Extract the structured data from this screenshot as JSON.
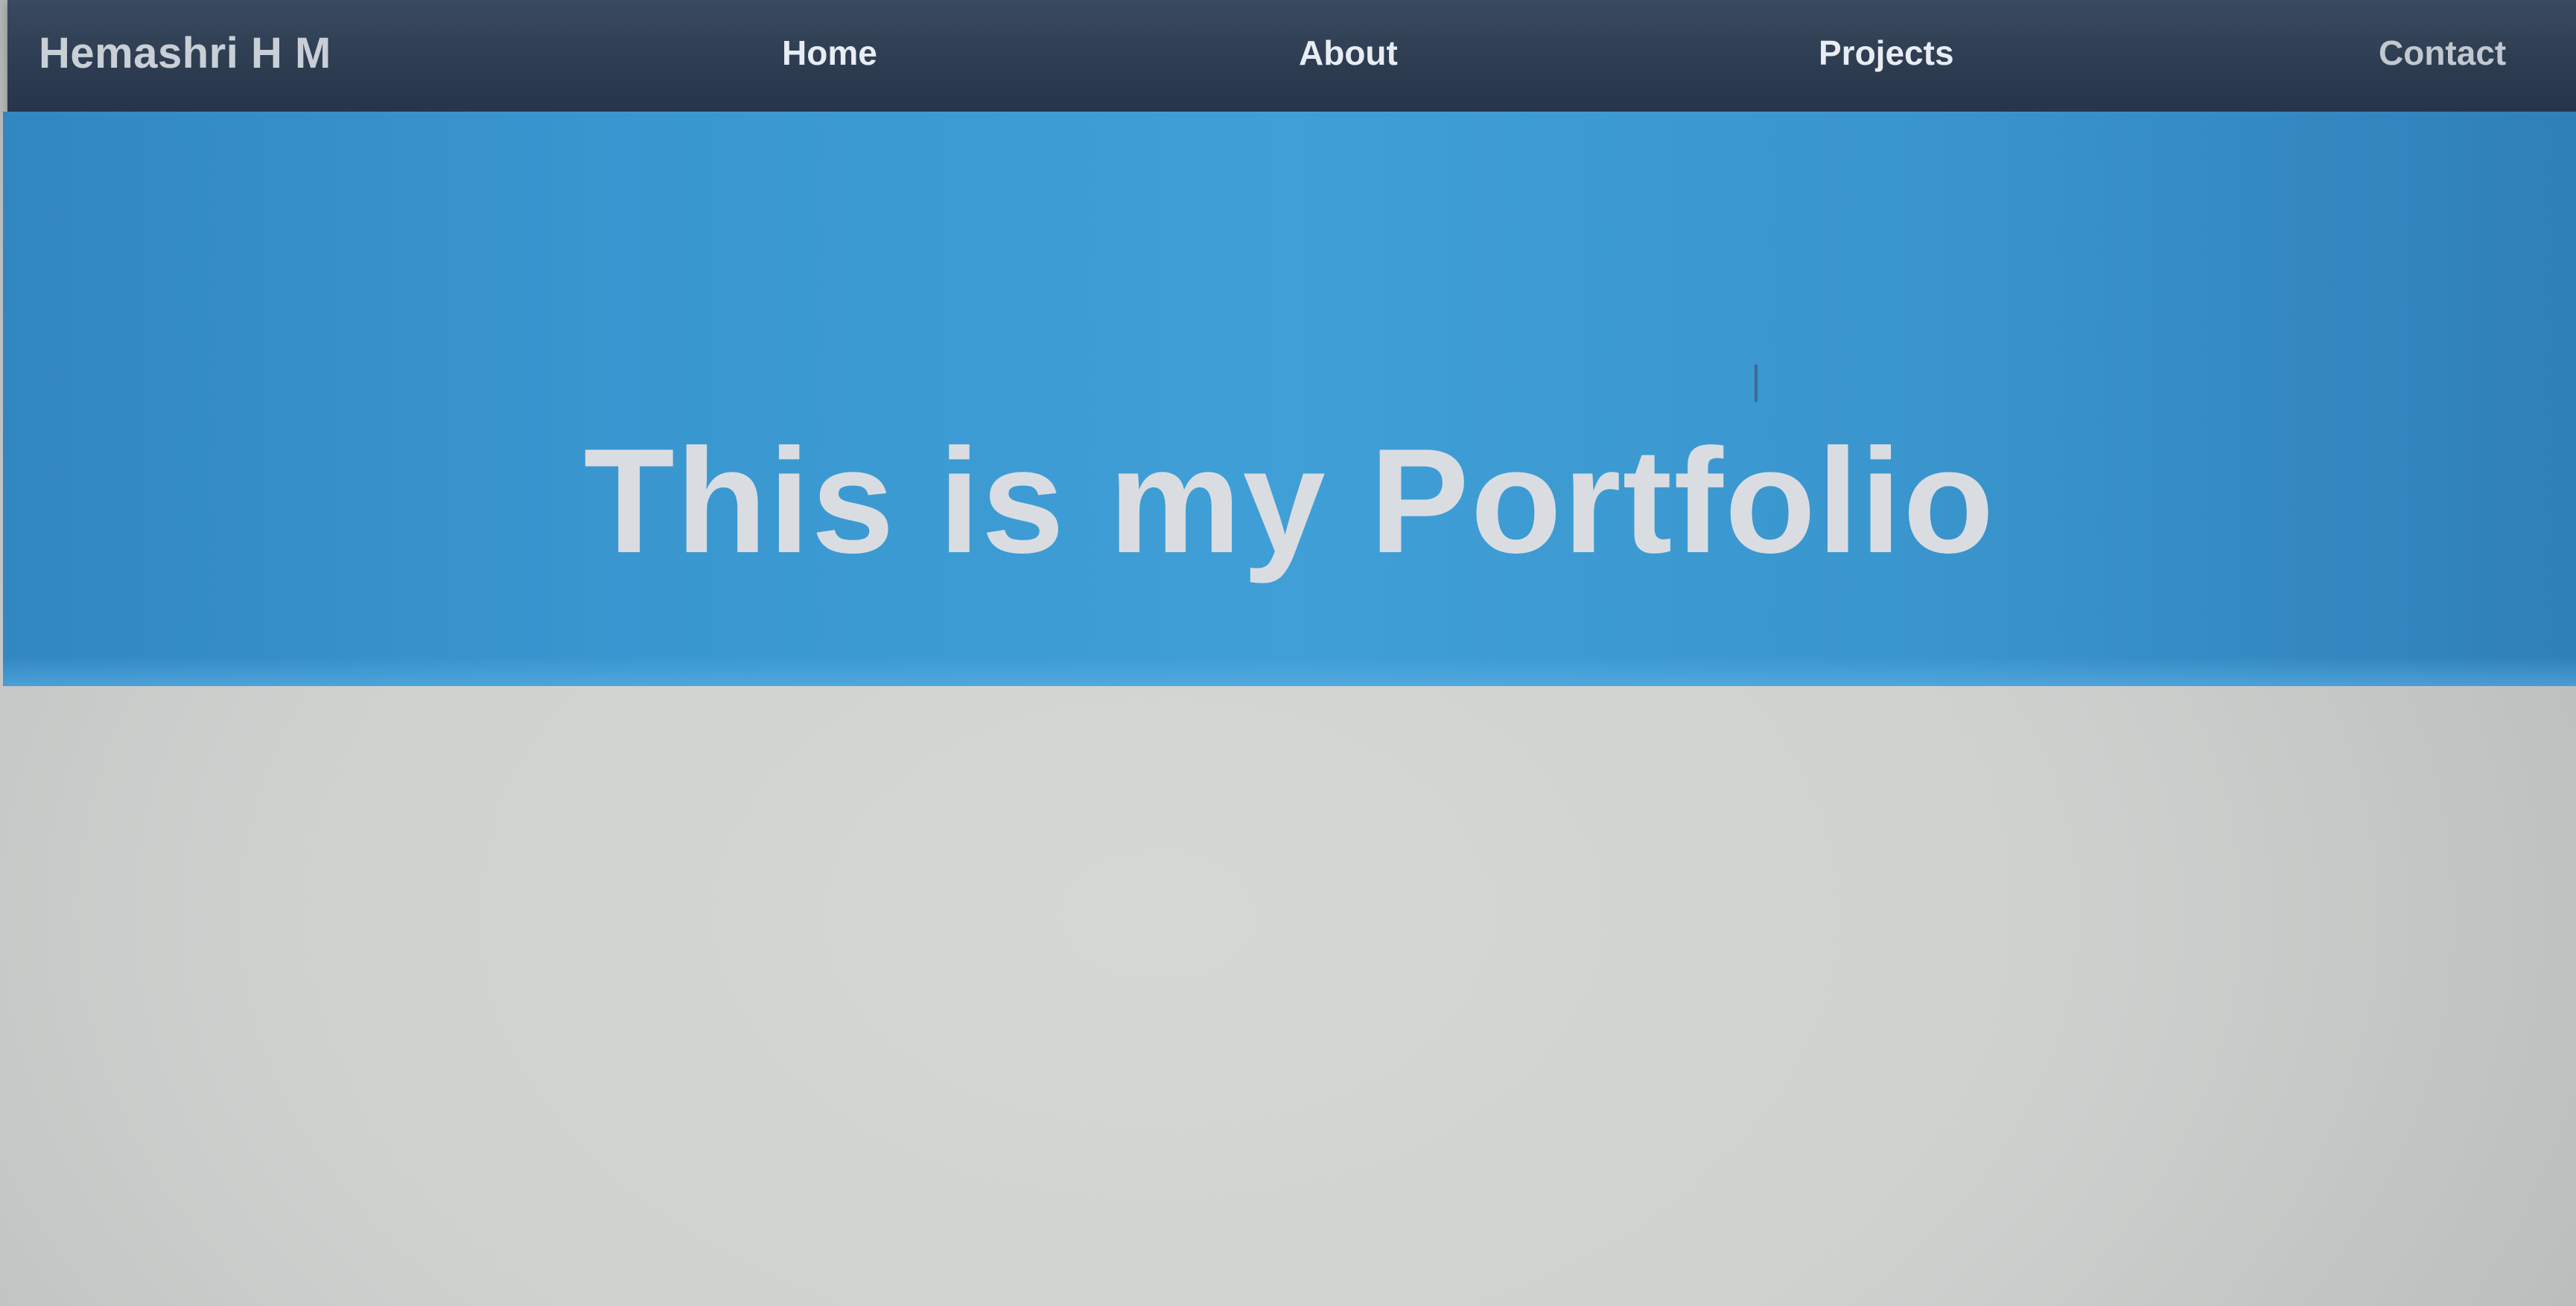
{
  "navbar": {
    "brand": "Hemashri H M",
    "links": [
      {
        "label": "Home"
      },
      {
        "label": "About"
      },
      {
        "label": "Projects"
      },
      {
        "label": "Contact"
      }
    ]
  },
  "hero": {
    "title": "This is my Portfolio"
  },
  "colors": {
    "navbar_bg": "#2d3c50",
    "hero_bg": "#3a97d0",
    "page_bg": "#cfd1cf",
    "hero_text": "#d9dde2"
  }
}
